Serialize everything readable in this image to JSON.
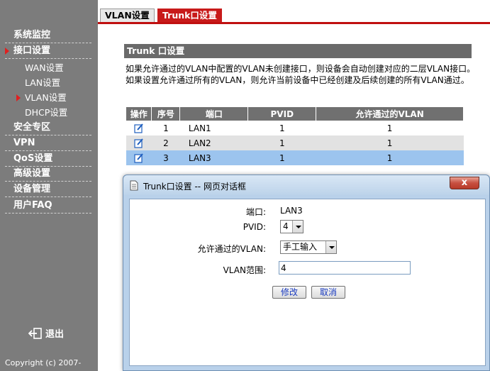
{
  "tabs": [
    {
      "label": "VLAN设置",
      "active": false
    },
    {
      "label": "Trunk口设置",
      "active": true
    }
  ],
  "sidebar": {
    "items": [
      {
        "label": "系统监控"
      },
      {
        "label": "接口设置"
      },
      {
        "label": "WAN设置"
      },
      {
        "label": "LAN设置"
      },
      {
        "label": "VLAN设置"
      },
      {
        "label": "DHCP设置"
      },
      {
        "label": "安全专区"
      },
      {
        "label": "VPN"
      },
      {
        "label": "QoS设置"
      },
      {
        "label": "高级设置"
      },
      {
        "label": "设备管理"
      },
      {
        "label": "用户FAQ"
      }
    ],
    "logout_label": "退出",
    "copyright": "Copyright (c) 2007-"
  },
  "main": {
    "section_title": "Trunk 口设置",
    "desc_line1": "如果允许通过的VLAN中配置的VLAN未创建接口，则设备会自动创建对应的二层VLAN接口。",
    "desc_line2": "如果设置允许通过所有的VLAN，则允许当前设备中已经创建及后续创建的所有VLAN通过。",
    "table": {
      "headers": [
        "操作",
        "序号",
        "端口",
        "PVID",
        "允许通过的VLAN"
      ],
      "rows": [
        {
          "index": "1",
          "port": "LAN1",
          "pvid": "1",
          "vlan": "1"
        },
        {
          "index": "2",
          "port": "LAN2",
          "pvid": "1",
          "vlan": "1"
        },
        {
          "index": "3",
          "port": "LAN3",
          "pvid": "1",
          "vlan": "1"
        }
      ]
    }
  },
  "dialog": {
    "title": "Trunk口设置 -- 网页对话框",
    "close_label": "x",
    "port_label": "端口:",
    "port_value": "LAN3",
    "pvid_label": "PVID:",
    "pvid_value": "4",
    "allowed_label": "允许通过的VLAN:",
    "allowed_value": "手工输入",
    "range_label": "VLAN范围:",
    "range_value": "4",
    "modify_label": "修改",
    "cancel_label": "取消"
  },
  "colors": {
    "sidebar_bg": "#7c7c7c",
    "tab_active": "#c81a1a",
    "header_gray": "#707070",
    "selected_row": "#9cc4ee",
    "dialog_frame": "#b9d1ea"
  }
}
